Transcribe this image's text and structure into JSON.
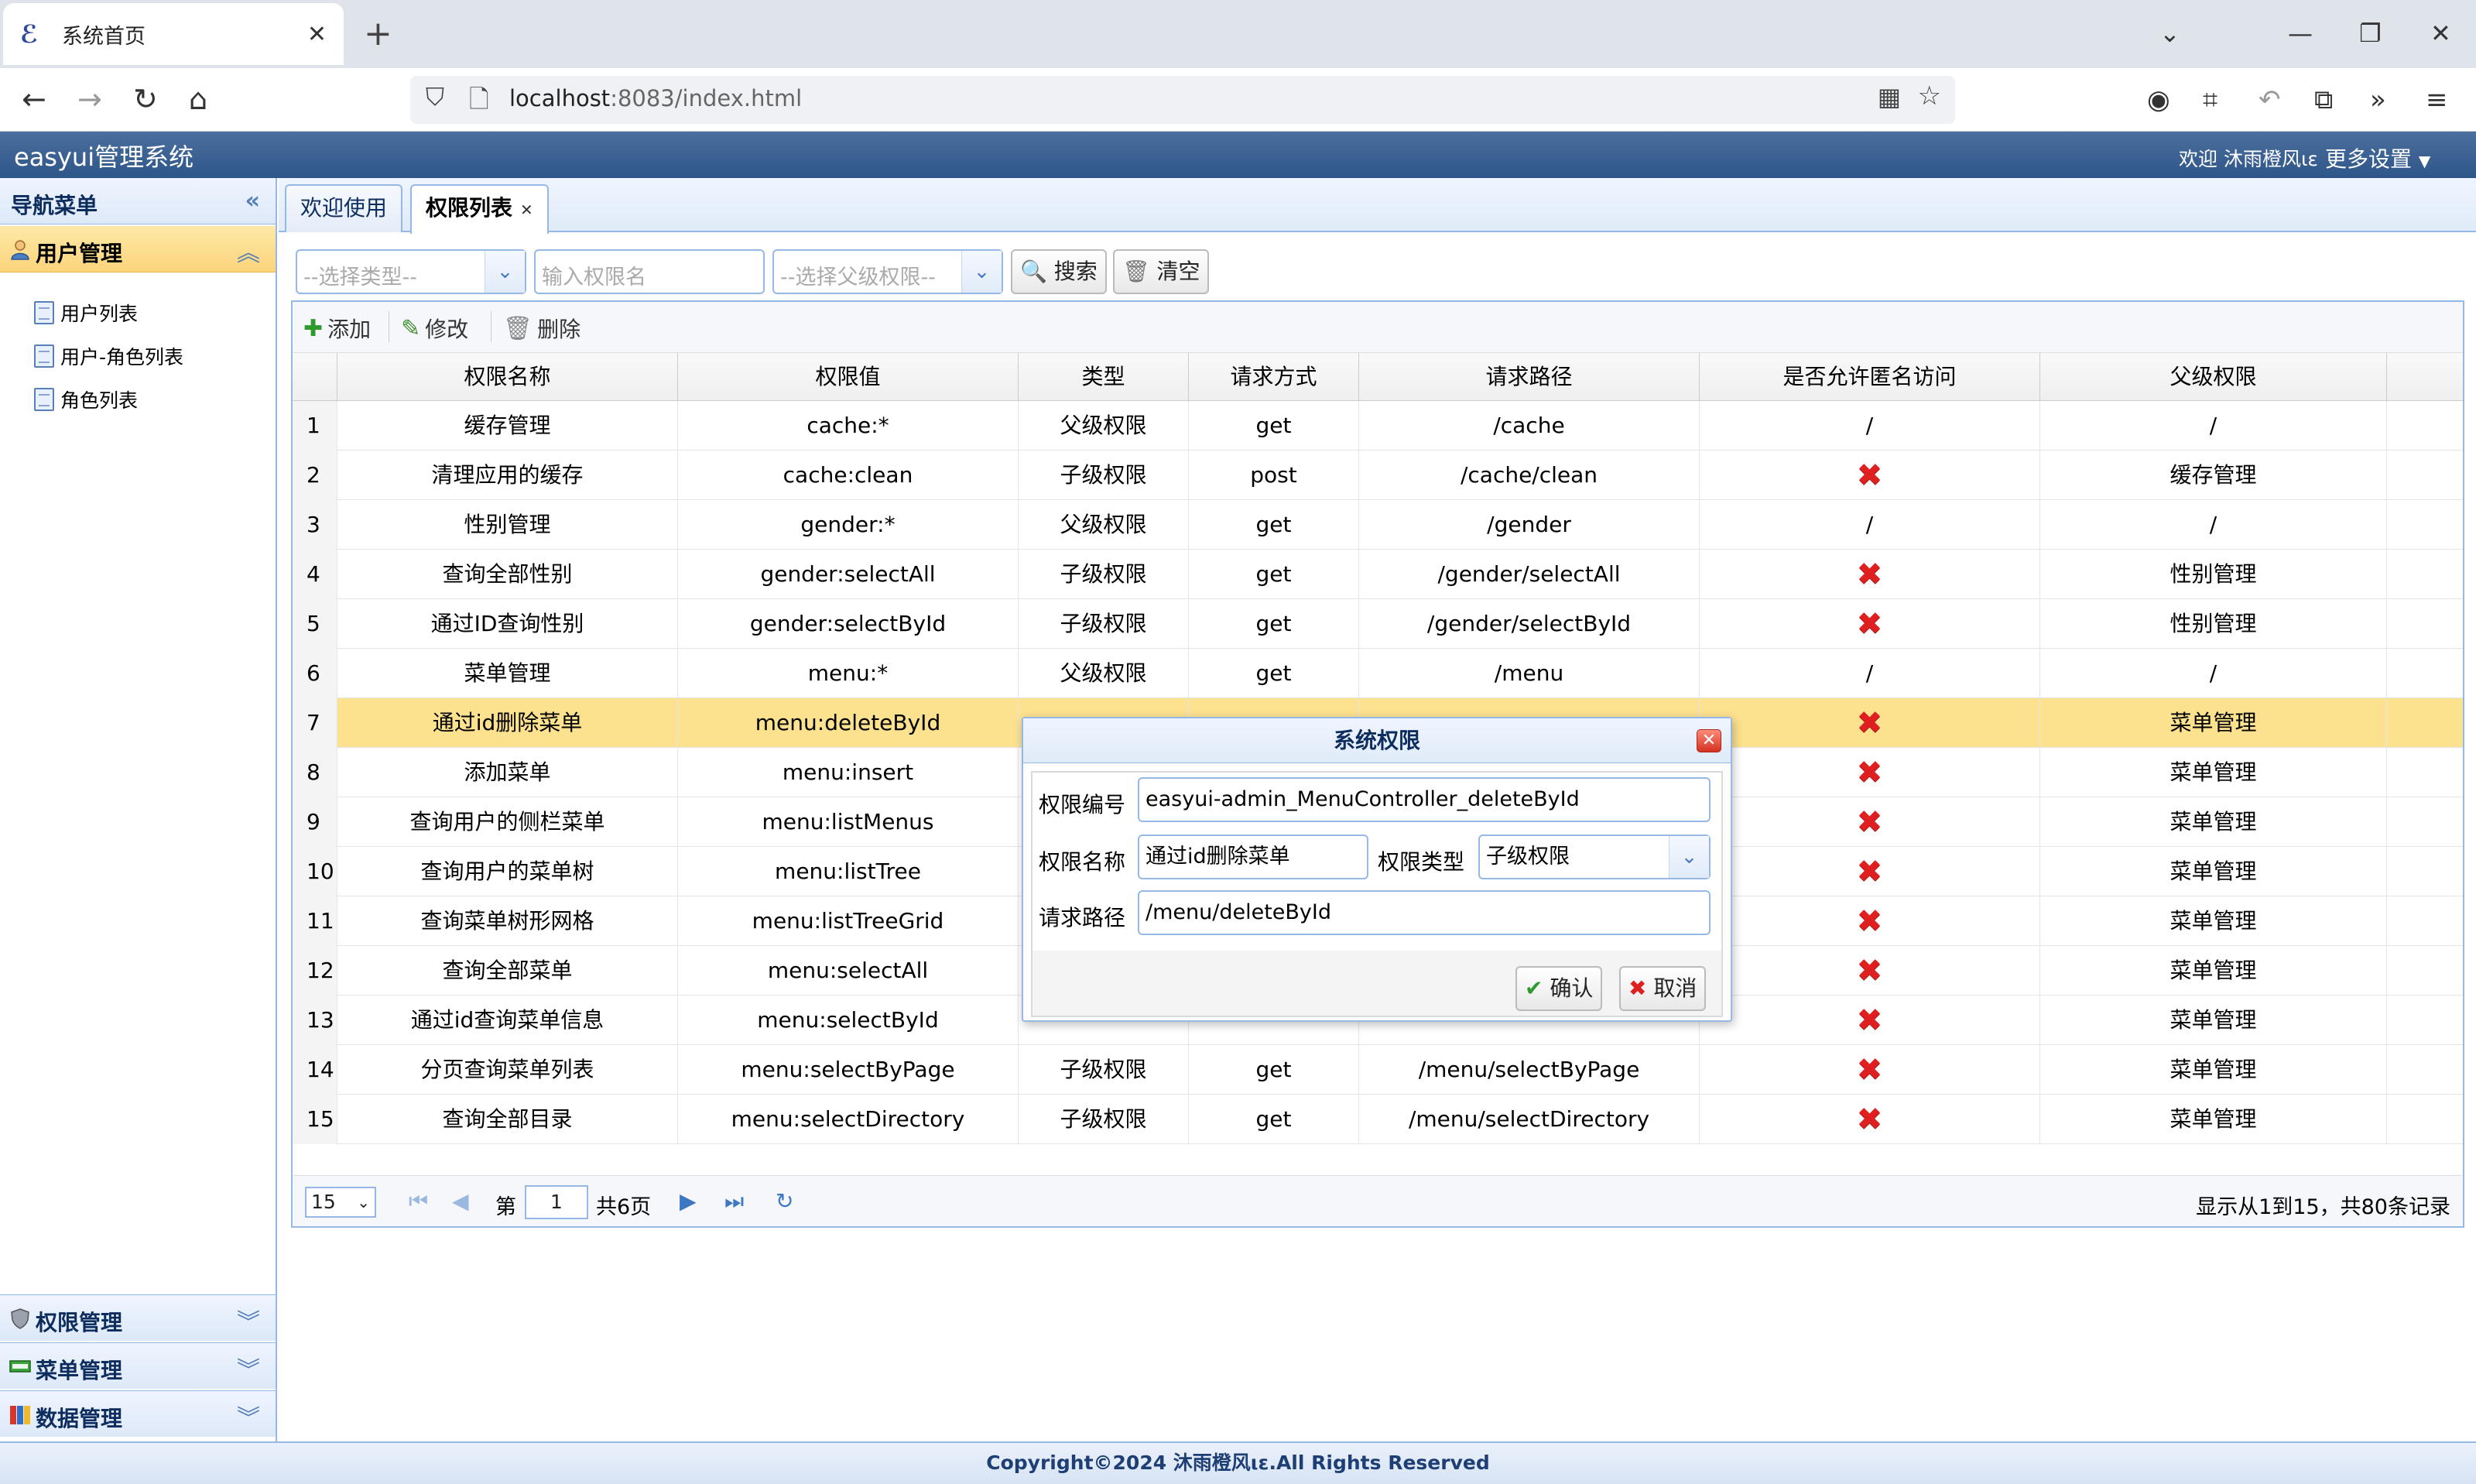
{
  "browser": {
    "tab_title": "系统首页",
    "url_host": "localhost",
    "url_rest": ":8083/index.html"
  },
  "header": {
    "title": "easyui管理系统",
    "welcome": "欢迎 沐雨橙风ιε",
    "more_settings": "更多设置"
  },
  "nav": {
    "title": "导航菜单",
    "sections": {
      "user": "用户管理",
      "permission": "权限管理",
      "menu": "菜单管理",
      "data": "数据管理"
    },
    "items": [
      "用户列表",
      "用户-角色列表",
      "角色列表"
    ]
  },
  "tabs": [
    {
      "label": "欢迎使用"
    },
    {
      "label": "权限列表"
    }
  ],
  "search": {
    "type_placeholder": "--选择类型--",
    "name_placeholder": "输入权限名",
    "parent_placeholder": "--选择父级权限--",
    "search_label": "搜索",
    "clear_label": "清空"
  },
  "grid_toolbar": {
    "add": "添加",
    "edit": "修改",
    "delete": "删除"
  },
  "columns": [
    "权限名称",
    "权限值",
    "类型",
    "请求方式",
    "请求路径",
    "是否允许匿名访问",
    "父级权限"
  ],
  "rows": [
    {
      "n": "1",
      "name": "缓存管理",
      "value": "cache:*",
      "type": "父级权限",
      "method": "get",
      "path": "/cache",
      "anon": "/",
      "parent": "/"
    },
    {
      "n": "2",
      "name": "清理应用的缓存",
      "value": "cache:clean",
      "type": "子级权限",
      "method": "post",
      "path": "/cache/clean",
      "anon": "x",
      "parent": "缓存管理"
    },
    {
      "n": "3",
      "name": "性别管理",
      "value": "gender:*",
      "type": "父级权限",
      "method": "get",
      "path": "/gender",
      "anon": "/",
      "parent": "/"
    },
    {
      "n": "4",
      "name": "查询全部性别",
      "value": "gender:selectAll",
      "type": "子级权限",
      "method": "get",
      "path": "/gender/selectAll",
      "anon": "x",
      "parent": "性别管理"
    },
    {
      "n": "5",
      "name": "通过ID查询性别",
      "value": "gender:selectById",
      "type": "子级权限",
      "method": "get",
      "path": "/gender/selectById",
      "anon": "x",
      "parent": "性别管理"
    },
    {
      "n": "6",
      "name": "菜单管理",
      "value": "menu:*",
      "type": "父级权限",
      "method": "get",
      "path": "/menu",
      "anon": "/",
      "parent": "/"
    },
    {
      "n": "7",
      "name": "通过id删除菜单",
      "value": "menu:deleteById",
      "type": "",
      "method": "",
      "path": "",
      "anon": "x",
      "parent": "菜单管理"
    },
    {
      "n": "8",
      "name": "添加菜单",
      "value": "menu:insert",
      "type": "",
      "method": "",
      "path": "",
      "anon": "x",
      "parent": "菜单管理"
    },
    {
      "n": "9",
      "name": "查询用户的侧栏菜单",
      "value": "menu:listMenus",
      "type": "",
      "method": "",
      "path": "",
      "anon": "x",
      "parent": "菜单管理"
    },
    {
      "n": "10",
      "name": "查询用户的菜单树",
      "value": "menu:listTree",
      "type": "",
      "method": "",
      "path": "",
      "anon": "x",
      "parent": "菜单管理"
    },
    {
      "n": "11",
      "name": "查询菜单树形网格",
      "value": "menu:listTreeGrid",
      "type": "",
      "method": "",
      "path": "",
      "anon": "x",
      "parent": "菜单管理"
    },
    {
      "n": "12",
      "name": "查询全部菜单",
      "value": "menu:selectAll",
      "type": "",
      "method": "",
      "path": "",
      "anon": "x",
      "parent": "菜单管理"
    },
    {
      "n": "13",
      "name": "通过id查询菜单信息",
      "value": "menu:selectById",
      "type": "",
      "method": "",
      "path": "",
      "anon": "x",
      "parent": "菜单管理"
    },
    {
      "n": "14",
      "name": "分页查询菜单列表",
      "value": "menu:selectByPage",
      "type": "子级权限",
      "method": "get",
      "path": "/menu/selectByPage",
      "anon": "x",
      "parent": "菜单管理"
    },
    {
      "n": "15",
      "name": "查询全部目录",
      "value": "menu:selectDirectory",
      "type": "子级权限",
      "method": "get",
      "path": "/menu/selectDirectory",
      "anon": "x",
      "parent": "菜单管理"
    }
  ],
  "pager": {
    "page_size": "15",
    "page_prefix": "第",
    "current_page": "1",
    "page_suffix": "共6页",
    "record_info": "显示从1到15，共80条记录"
  },
  "dialog": {
    "title": "系统权限",
    "id_label": "权限编号",
    "id_value": "easyui-admin_MenuController_deleteById",
    "name_label": "权限名称",
    "name_value": "通过id删除菜单",
    "type_label": "权限类型",
    "type_value": "子级权限",
    "path_label": "请求路径",
    "path_value": "/menu/deleteById",
    "confirm": "确认",
    "cancel": "取消"
  },
  "footer": "Copyright©2024 沐雨橙风ιε.All Rights Reserved",
  "colors": {
    "header": "#2e5688",
    "border": "#95b8e7",
    "selected_row": "#fce18e",
    "delete_mark": "#e02020"
  }
}
